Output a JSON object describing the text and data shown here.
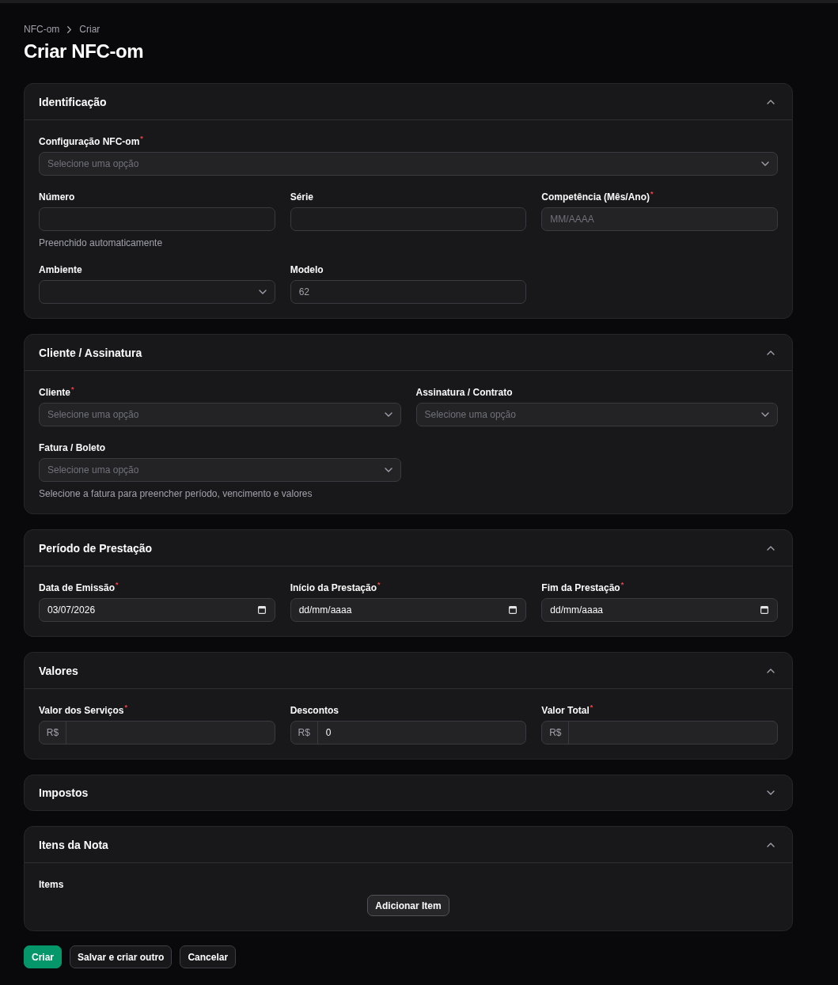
{
  "breadcrumbs": [
    {
      "label": "NFC-om"
    },
    {
      "label": "Criar"
    }
  ],
  "title": "Criar NFC-om",
  "sections": [
    {
      "title": "Identificação",
      "expanded": true,
      "fields": [
        {
          "kind": "select",
          "label": "Configuração NFC-om$^{*}$",
          "placeholder": "Selecione uma opção",
          "disabled": false
        },
        {
          "kind": "text",
          "label": "Número",
          "disabled": true,
          "helper": "Preenchido automaticamente"
        },
        {
          "kind": "text",
          "label": "Série",
          "disabled": true
        },
        {
          "kind": "text",
          "label": "Competência (Mês/Ano)$^{*}$",
          "placeholder": "MM/AAAA",
          "disabled": false
        },
        {
          "kind": "select",
          "label": "Ambiente",
          "disabled": true
        },
        {
          "kind": "text",
          "label": "Modelo",
          "value": "62",
          "disabled": true
        }
      ]
    },
    {
      "title": "Cliente / Assinatura",
      "expanded": true,
      "fields": [
        {
          "kind": "select",
          "label": "Cliente$^{*}$",
          "placeholder": "Selecione uma opção",
          "disabled": false
        },
        {
          "kind": "select",
          "label": "Assinatura / Contrato",
          "placeholder": "Selecione uma opção",
          "disabled": false
        },
        {
          "kind": "select",
          "label": "Fatura / Boleto",
          "placeholder": "Selecione uma opção",
          "disabled": false,
          "helper": "Selecione a fatura para preencher período, vencimento e valores"
        }
      ]
    },
    {
      "title": "Período de Prestação",
      "expanded": true,
      "fields": [
        {
          "kind": "date",
          "label": "Data de Emissão$^{*}$",
          "value": "03/07/2026",
          "disabled": false
        },
        {
          "kind": "date",
          "label": "Início da Prestação$^{*}$",
          "placeholder": "dd/mm/aaaa",
          "disabled": false
        },
        {
          "kind": "date",
          "label": "Fim da Prestação$^{*}$",
          "placeholder": "dd/mm/aaaa",
          "disabled": false
        }
      ]
    },
    {
      "title": "Valores",
      "expanded": true,
      "fields": [
        {
          "kind": "money",
          "label": "Valor dos Serviços$^{*}$",
          "prefix": "R$",
          "disabled": false
        },
        {
          "kind": "money",
          "label": "Descontos",
          "prefix": "R$",
          "value": "0",
          "disabled": false
        },
        {
          "kind": "money",
          "label": "Valor Total$^{*}$",
          "prefix": "R$",
          "disabled": false
        }
      ]
    },
    {
      "title": "Impostos",
      "expanded": false
    },
    {
      "title": "Itens da Nota",
      "expanded": true,
      "repeater": {
        "label": "Items",
        "button": "Adicionar Item"
      }
    }
  ],
  "actions": [
    {
      "label": "Criar",
      "kind": "primary"
    },
    {
      "label": "Salvar e criar outro",
      "kind": "secondary"
    },
    {
      "label": "Cancelar",
      "kind": "secondary"
    }
  ]
}
